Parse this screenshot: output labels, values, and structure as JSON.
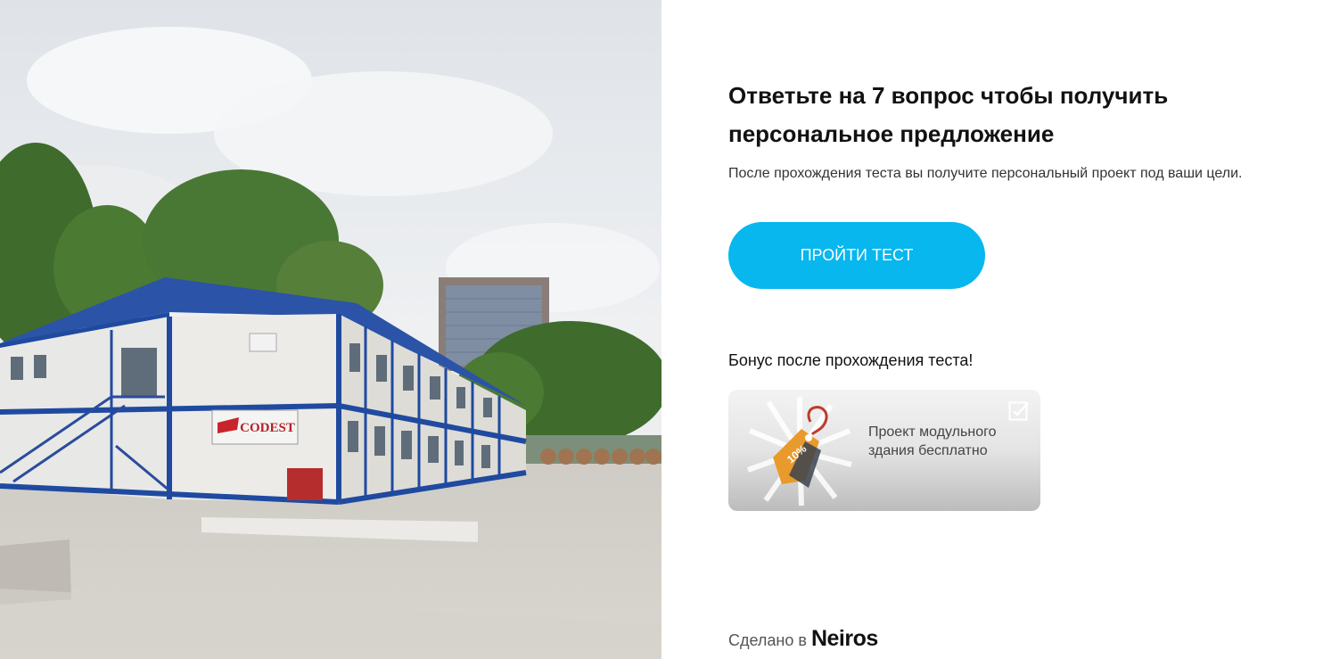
{
  "hero_image": {
    "sign_text": "CODEST"
  },
  "quiz": {
    "title": "Ответьте на 7 вопрос чтобы получить персональное предложение",
    "subtitle": "После прохождения теста вы получите персональный проект под ваши цели.",
    "start_button_label": "ПРОЙТИ ТЕСТ"
  },
  "bonus": {
    "heading": "Бонус после прохождения теста!",
    "card_text": "Проект модульного здания бесплатно",
    "tag_text": "10%",
    "check_icon": "checkbox-icon",
    "tag_icon": "discount-tag-icon"
  },
  "footer": {
    "made_in_label": "Сделано в",
    "brand_name": "Neiros"
  },
  "colors": {
    "accent": "#07b7ee",
    "text": "#111111",
    "building_blue": "#1f4aa0"
  }
}
